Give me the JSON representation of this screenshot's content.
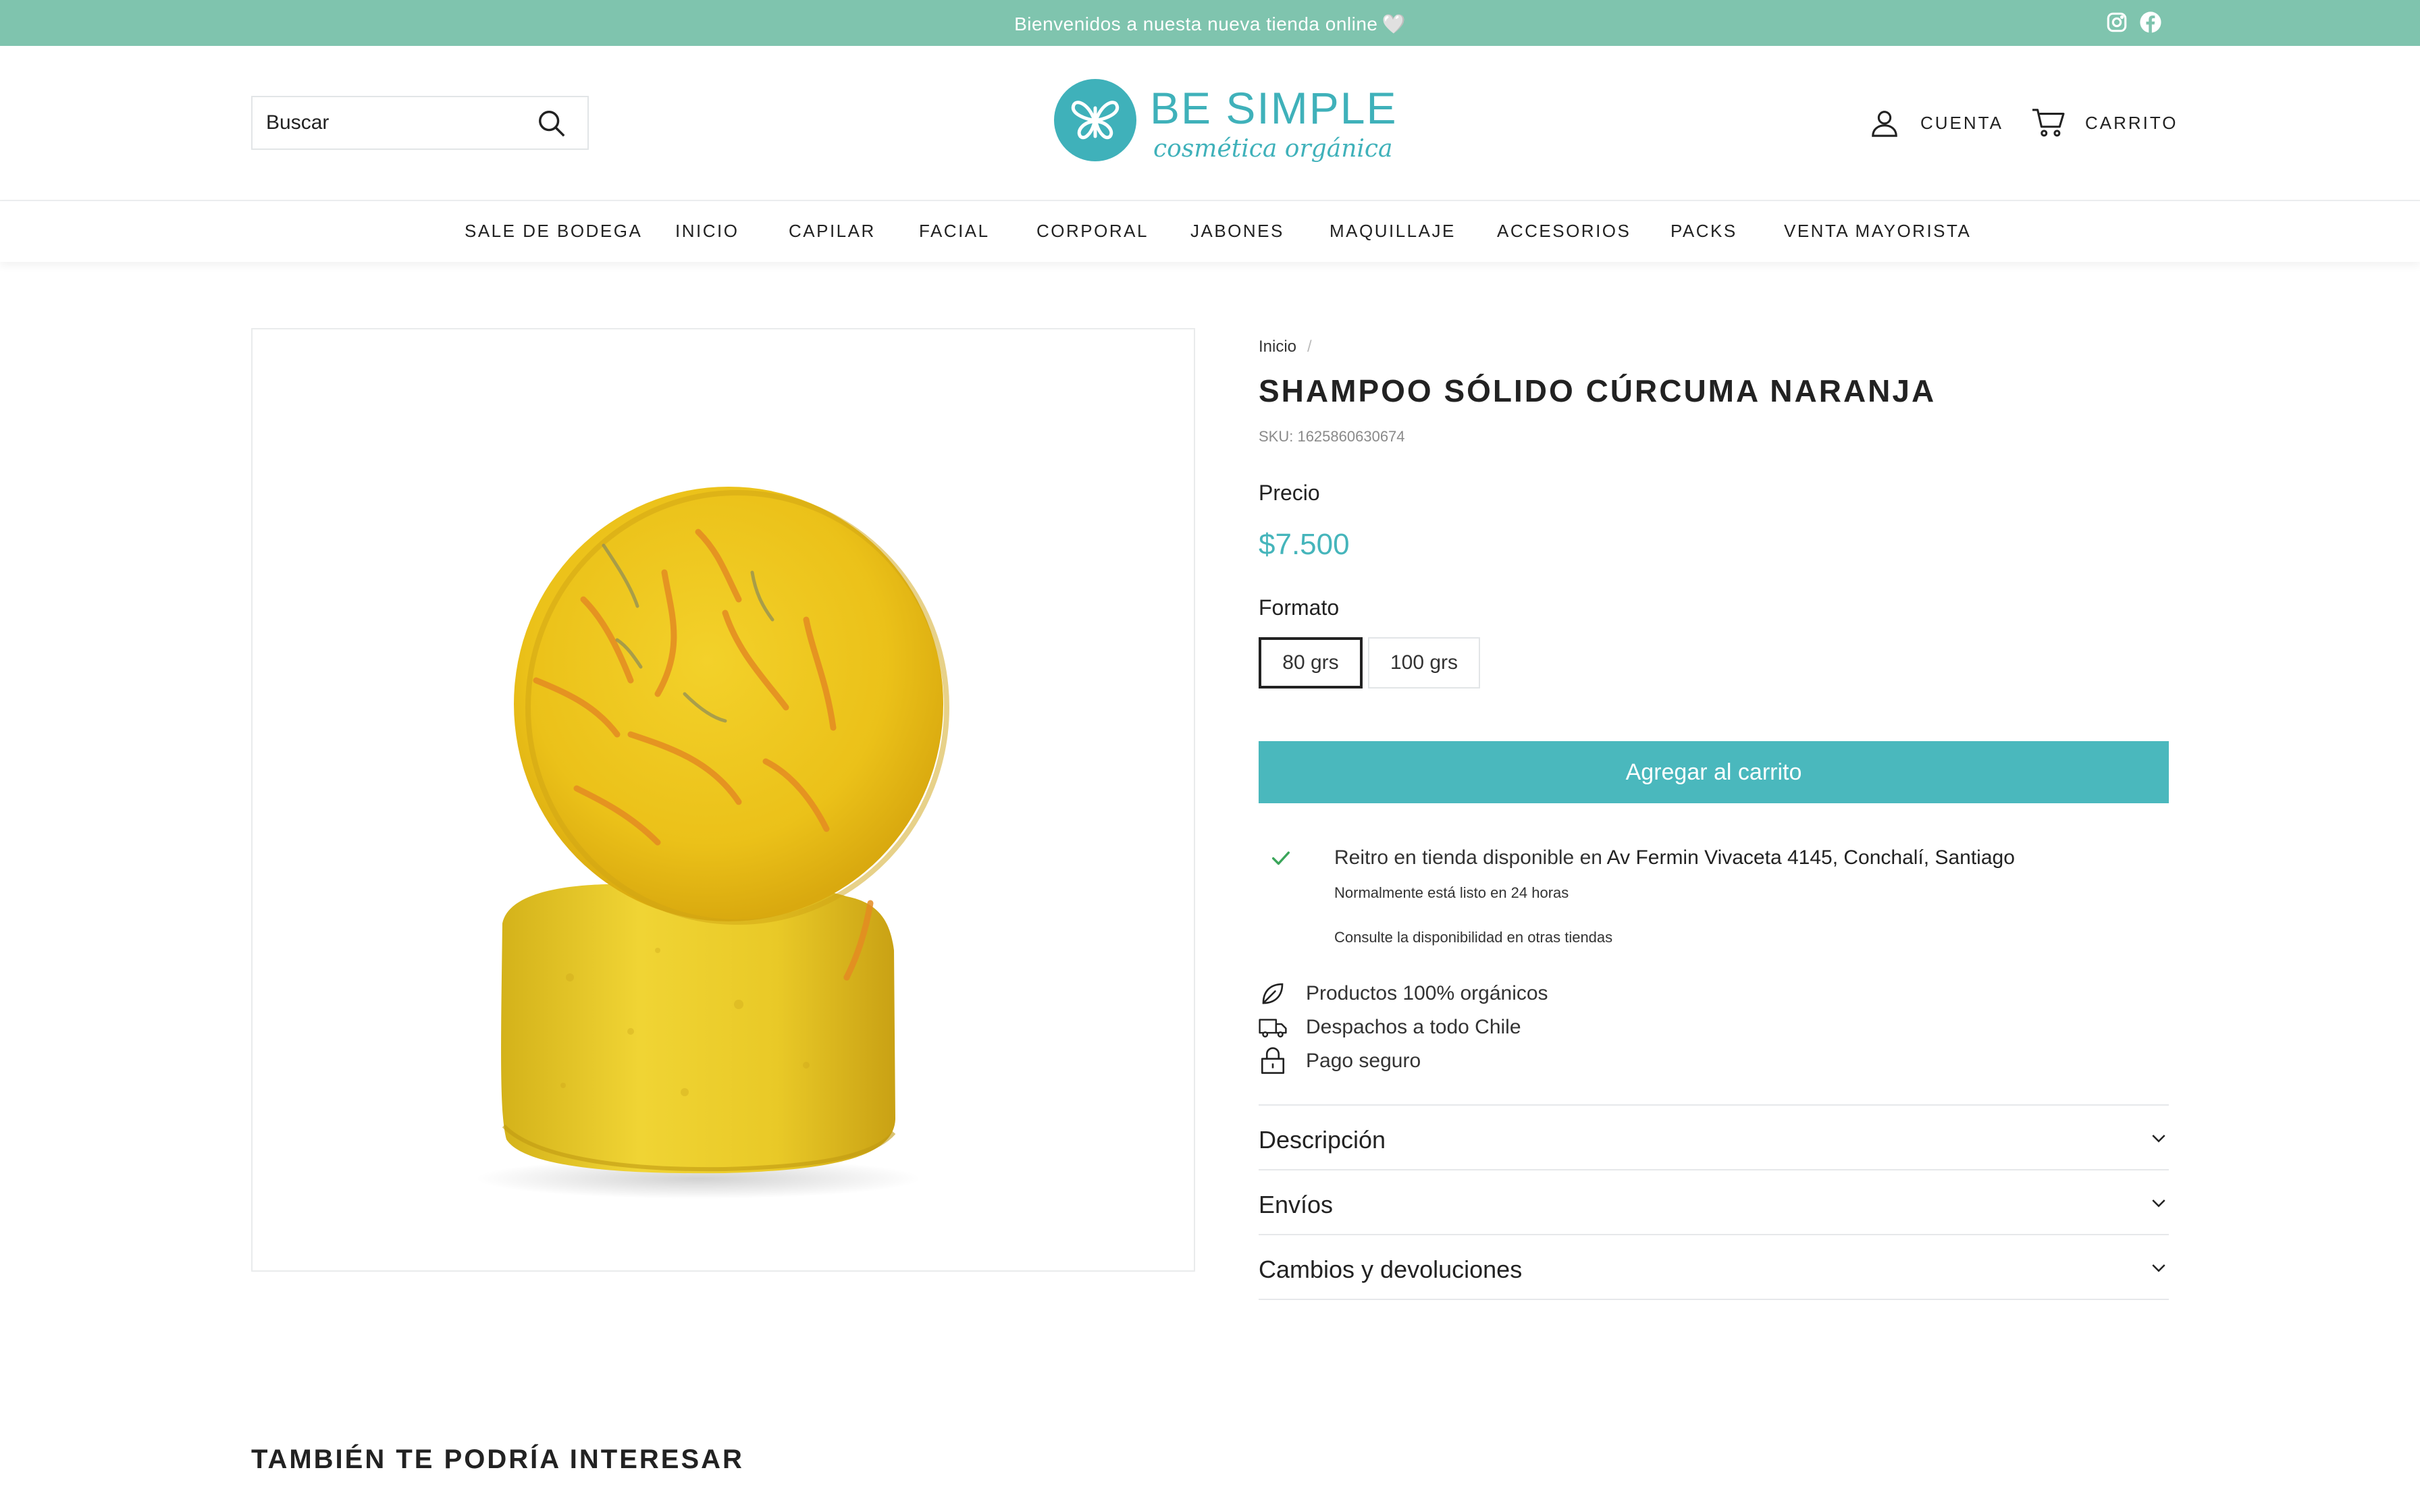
{
  "announcement": {
    "text": "Bienvenidos a nuesta nueva tienda online",
    "heart": "🤍",
    "social": [
      "instagram-icon",
      "facebook-icon"
    ]
  },
  "header": {
    "search_placeholder": "Buscar",
    "logo_name": "BE SIMPLE",
    "logo_tagline": "cosmética orgánica",
    "account_label": "CUENTA",
    "cart_label": "CARRITO"
  },
  "nav": {
    "items": [
      {
        "label": "SALE DE BODEGA"
      },
      {
        "label": "INICIO"
      },
      {
        "label": "CAPILAR"
      },
      {
        "label": "FACIAL"
      },
      {
        "label": "CORPORAL"
      },
      {
        "label": "JABONES"
      },
      {
        "label": "MAQUILLAJE"
      },
      {
        "label": "ACCESORIOS"
      },
      {
        "label": "PACKS"
      },
      {
        "label": "VENTA MAYORISTA"
      }
    ]
  },
  "product": {
    "breadcrumb": "Inicio",
    "breadcrumb_sep": "/",
    "title": "SHAMPOO SÓLIDO CÚRCUMA NARANJA",
    "sku": "SKU: 1625860630674",
    "price_label": "Precio",
    "price": "$7.500",
    "format_label": "Formato",
    "options": [
      {
        "label": "80 grs",
        "selected": true
      },
      {
        "label": "100 grs",
        "selected": false
      }
    ],
    "add_to_cart": "Agregar al carrito"
  },
  "pickup": {
    "text": "Reitro en tienda disponible en",
    "location": "Av Fermin Vivaceta 4145, Conchalí, Santiago",
    "ready": "Normalmente está listo en 24 horas",
    "link": "Consulte la disponibilidad en otras tiendas"
  },
  "features": [
    {
      "label": "Productos 100% orgánicos",
      "icon": "leaf-icon"
    },
    {
      "label": "Despachos a todo Chile",
      "icon": "truck-icon"
    },
    {
      "label": "Pago seguro",
      "icon": "lock-icon"
    }
  ],
  "accordion": [
    {
      "title": "Descripción"
    },
    {
      "title": "Envíos"
    },
    {
      "title": "Cambios y devoluciones"
    }
  ],
  "related_title": "TAMBIÉN TE PODRÍA INTERESAR",
  "colors": {
    "announcement_bg": "#7fc4ae",
    "brand": "#3fb1ba",
    "button": "#4ab8bd",
    "price": "#45b5bb"
  }
}
